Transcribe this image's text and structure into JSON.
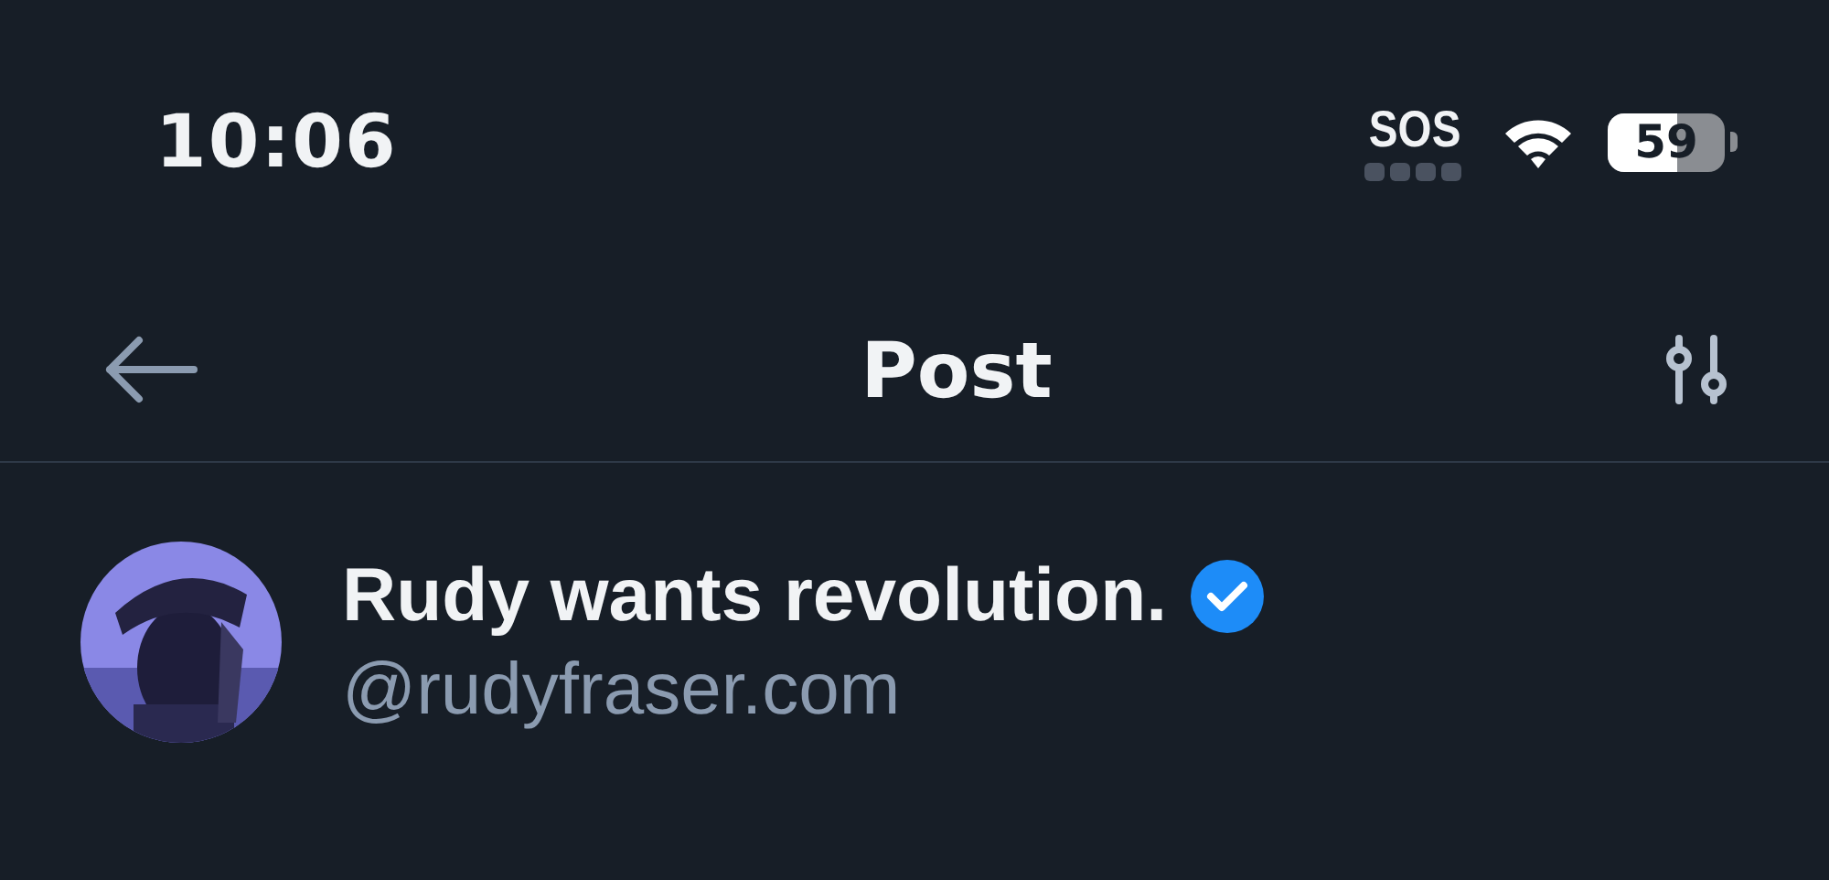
{
  "status_bar": {
    "time": "10:06",
    "carrier": "SOS",
    "battery": "59"
  },
  "header": {
    "title": "Post"
  },
  "author": {
    "name": "Rudy wants revolution.",
    "verified": true,
    "handle": "@rudyfraser.com"
  }
}
